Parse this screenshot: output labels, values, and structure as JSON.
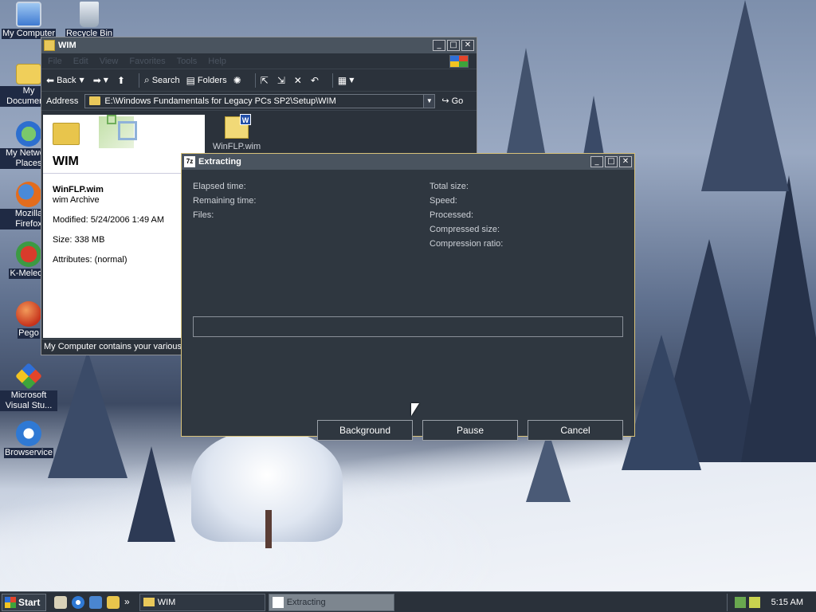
{
  "desktop": {
    "icons": [
      {
        "label": "My Computer",
        "icon": "computer-icon"
      },
      {
        "label": "Recycle Bin",
        "icon": "recycle-bin-icon"
      },
      {
        "label": "My Documents",
        "icon": "folder-icon"
      },
      {
        "label": "My Network Places",
        "icon": "network-places-icon"
      },
      {
        "label": "Mozilla Firefox",
        "icon": "firefox-icon"
      },
      {
        "label": "K-Meleon",
        "icon": "k-meleon-icon"
      },
      {
        "label": "Pego",
        "icon": "pego-icon"
      },
      {
        "label": "Microsoft Visual Stu...",
        "icon": "visual-studio-icon"
      },
      {
        "label": "Browservice",
        "icon": "browser-icon"
      }
    ]
  },
  "explorer": {
    "title": "WIM",
    "menu": [
      "File",
      "Edit",
      "View",
      "Favorites",
      "Tools",
      "Help"
    ],
    "toolbar": {
      "back": "Back",
      "search": "Search",
      "folders": "Folders"
    },
    "address": {
      "label": "Address",
      "value": "E:\\Windows Fundamentals for Legacy PCs SP2\\Setup\\WIM",
      "go": "Go"
    },
    "panel": {
      "title": "WIM",
      "file_name": "WinFLP.wim",
      "file_type": "wim Archive",
      "modified": "Modified: 5/24/2006 1:49 AM",
      "size": "Size: 338 MB",
      "attributes": "Attributes: (normal)"
    },
    "file_item": {
      "label": "WinFLP.wim",
      "badge": "W"
    },
    "status": "My Computer contains your various"
  },
  "dialog": {
    "title": "Extracting",
    "icon_text": "7z",
    "left_labels": {
      "elapsed": "Elapsed time:",
      "remaining": "Remaining time:",
      "files": "Files:"
    },
    "right_labels": {
      "total": "Total size:",
      "speed": "Speed:",
      "processed": "Processed:",
      "compressed": "Compressed size:",
      "ratio": "Compression ratio:"
    },
    "progress": 0,
    "buttons": {
      "background": "Background",
      "pause": "Pause",
      "cancel": "Cancel"
    }
  },
  "taskbar": {
    "start": "Start",
    "quicklaunch_more": "»",
    "tasks": [
      {
        "label": "WIM",
        "active": false
      },
      {
        "label": "Extracting",
        "active": true
      }
    ],
    "clock": "5:15 AM"
  }
}
